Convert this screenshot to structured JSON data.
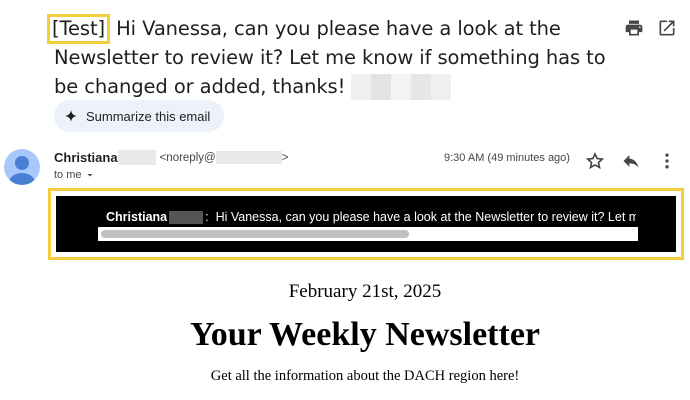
{
  "email": {
    "subject_tag": "[Test]",
    "subject_text": " Hi Vanessa, can you please have a look at the Newsletter to review it? Let me know if something has to be changed or added, thanks! ",
    "summarize_label": "Summarize this email",
    "sender_name": "Christiana",
    "sender_email_prefix": "<noreply@",
    "sender_email_suffix": ">",
    "recipient_label": "to me",
    "time": "9:30 AM (49 minutes ago)",
    "icons": {
      "print": "print-icon",
      "open_new_window": "open-in-new-window-icon",
      "star": "star-icon",
      "reply": "reply-icon",
      "more": "more-vert-icon"
    }
  },
  "preview": {
    "sender": "Christiana",
    "separator": ":",
    "message": "Hi Vanessa, can you please have a look at the Newsletter to review it? Let me know if something has to be changed or added, thanks!"
  },
  "newsletter": {
    "date": "February 21st, 2025",
    "title": "Your Weekly Newsletter",
    "subtitle": "Get all the information about the DACH region here!"
  },
  "colors": {
    "highlight": "#f2cf3a",
    "chip_background": "#edf2fa",
    "avatar": "#a8c7fa"
  }
}
